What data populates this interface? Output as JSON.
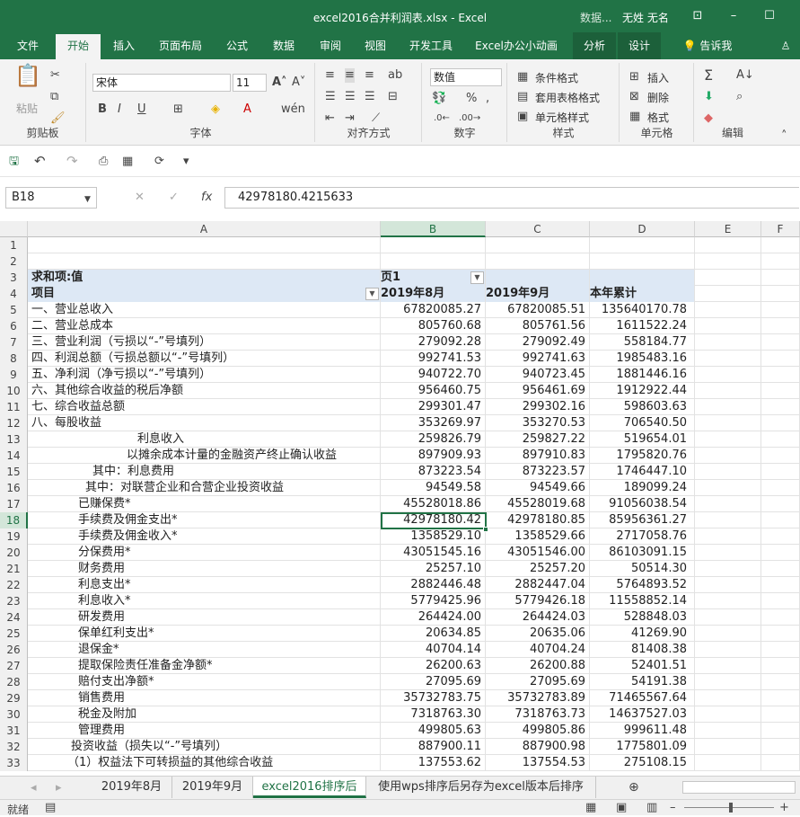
{
  "window": {
    "title": "excel2016合并利润表.xlsx  -  Excel",
    "hint": "数据...",
    "user": "无姓 无名"
  },
  "tabs": [
    "文件",
    "开始",
    "插入",
    "页面布局",
    "公式",
    "数据",
    "审阅",
    "视图",
    "开发工具",
    "Excel办公小动画",
    "分析",
    "设计",
    "告诉我"
  ],
  "ribbon": {
    "paste": "粘贴",
    "font_name": "宋体",
    "font_size": "11",
    "number_format": "数值",
    "cond_format": "条件格式",
    "table_format": "套用表格格式",
    "cell_style": "单元格样式",
    "insert": "插入",
    "delete": "删除",
    "format": "格式",
    "percent": "%",
    "comma": ",",
    "groups": {
      "clipboard": "剪贴板",
      "font": "字体",
      "align": "对齐方式",
      "number": "数字",
      "style": "样式",
      "cells": "单元格",
      "edit": "编辑"
    }
  },
  "formula_bar": {
    "cell_ref": "B18",
    "value": "42978180.4215633"
  },
  "columns": [
    "A",
    "B",
    "C",
    "D",
    "E",
    "F"
  ],
  "rows": [
    {
      "n": "1",
      "a": "",
      "b": "",
      "c": "",
      "d": ""
    },
    {
      "n": "2",
      "a": "",
      "b": "",
      "c": "",
      "d": ""
    },
    {
      "n": "3",
      "a": "求和项:值",
      "b": "页1",
      "c": "",
      "d": ""
    },
    {
      "n": "4",
      "a": "项目",
      "b": "2019年8月",
      "c": "2019年9月",
      "d": "本年累计"
    },
    {
      "n": "5",
      "a": "一、营业总收入",
      "b": "67820085.27",
      "c": "67820085.51",
      "d": "135640170.78"
    },
    {
      "n": "6",
      "a": "二、营业总成本",
      "b": "805760.68",
      "c": "805761.56",
      "d": "1611522.24"
    },
    {
      "n": "7",
      "a": "三、营业利润（亏损以“-”号填列）",
      "b": "279092.28",
      "c": "279092.49",
      "d": "558184.77"
    },
    {
      "n": "8",
      "a": "四、利润总额（亏损总额以“-”号填列）",
      "b": "992741.53",
      "c": "992741.63",
      "d": "1985483.16"
    },
    {
      "n": "9",
      "a": "五、净利润（净亏损以“-”号填列）",
      "b": "940722.70",
      "c": "940723.45",
      "d": "1881446.16"
    },
    {
      "n": "10",
      "a": "六、其他综合收益的税后净额",
      "b": "956460.75",
      "c": "956461.69",
      "d": "1912922.44"
    },
    {
      "n": "11",
      "a": "七、综合收益总额",
      "b": "299301.47",
      "c": "299302.16",
      "d": "598603.63"
    },
    {
      "n": "12",
      "a": "八、每股收益",
      "b": "353269.97",
      "c": "353270.53",
      "d": "706540.50"
    },
    {
      "n": "13",
      "a": "利息收入",
      "b": "259826.79",
      "c": "259827.22",
      "d": "519654.01"
    },
    {
      "n": "14",
      "a": "以摊余成本计量的金融资产终止确认收益",
      "b": "897909.93",
      "c": "897910.83",
      "d": "1795820.76"
    },
    {
      "n": "15",
      "a": "其中：利息费用",
      "b": "873223.54",
      "c": "873223.57",
      "d": "1746447.10"
    },
    {
      "n": "16",
      "a": "其中：对联营企业和合营企业投资收益",
      "b": "94549.58",
      "c": "94549.66",
      "d": "189099.24"
    },
    {
      "n": "17",
      "a": "已赚保费*",
      "b": "45528018.86",
      "c": "45528019.68",
      "d": "91056038.54"
    },
    {
      "n": "18",
      "a": "手续费及佣金支出*",
      "b": "42978180.42",
      "c": "42978180.85",
      "d": "85956361.27"
    },
    {
      "n": "19",
      "a": "手续费及佣金收入*",
      "b": "1358529.10",
      "c": "1358529.66",
      "d": "2717058.76"
    },
    {
      "n": "20",
      "a": "分保费用*",
      "b": "43051545.16",
      "c": "43051546.00",
      "d": "86103091.15"
    },
    {
      "n": "21",
      "a": "财务费用",
      "b": "25257.10",
      "c": "25257.20",
      "d": "50514.30"
    },
    {
      "n": "22",
      "a": "利息支出*",
      "b": "2882446.48",
      "c": "2882447.04",
      "d": "5764893.52"
    },
    {
      "n": "23",
      "a": "利息收入*",
      "b": "5779425.96",
      "c": "5779426.18",
      "d": "11558852.14"
    },
    {
      "n": "24",
      "a": "研发费用",
      "b": "264424.00",
      "c": "264424.03",
      "d": "528848.03"
    },
    {
      "n": "25",
      "a": "保单红利支出*",
      "b": "20634.85",
      "c": "20635.06",
      "d": "41269.90"
    },
    {
      "n": "26",
      "a": "退保金*",
      "b": "40704.14",
      "c": "40704.24",
      "d": "81408.38"
    },
    {
      "n": "27",
      "a": "提取保险责任准备金净额*",
      "b": "26200.63",
      "c": "26200.88",
      "d": "52401.51"
    },
    {
      "n": "28",
      "a": "赔付支出净额*",
      "b": "27095.69",
      "c": "27095.69",
      "d": "54191.38"
    },
    {
      "n": "29",
      "a": "销售费用",
      "b": "35732783.75",
      "c": "35732783.89",
      "d": "71465567.64"
    },
    {
      "n": "30",
      "a": "税金及附加",
      "b": "7318763.30",
      "c": "7318763.73",
      "d": "14637527.03"
    },
    {
      "n": "31",
      "a": "管理费用",
      "b": "499805.63",
      "c": "499805.86",
      "d": "999611.48"
    },
    {
      "n": "32",
      "a": "投资收益（损失以“-”号填列）",
      "b": "887900.11",
      "c": "887900.98",
      "d": "1775801.09"
    },
    {
      "n": "33",
      "a": "（1）权益法下可转损益的其他综合收益",
      "b": "137553.62",
      "c": "137554.53",
      "d": "275108.15"
    }
  ],
  "sheets": [
    "2019年8月",
    "2019年9月",
    "excel2016排序后",
    "使用wps排序后另存为excel版本后排序"
  ],
  "status": {
    "ready": "就绪"
  }
}
